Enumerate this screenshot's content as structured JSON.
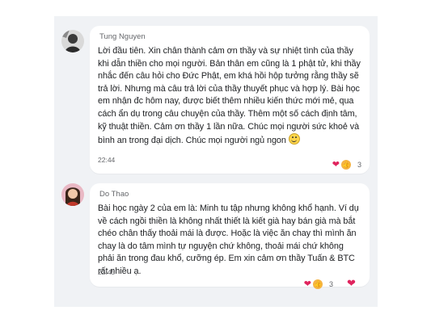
{
  "comments": [
    {
      "author": "Tung Nguyen",
      "text": "Lời đầu tiên. Xin chân thành cảm ơn thầy và sự nhiệt tình của thầy khi dẫn thiền cho mọi người. Bản thân em cũng là 1 phật tử, khi thầy nhắc đến câu hỏi cho Đức Phật, em khá hồi hộp tưởng rằng thầy sẽ trả lời. Nhưng mà câu trả lời của thầy thuyết phục và hợp lý. Bài học em nhận đc hôm nay, được biết thêm nhiều kiến thức mới mẻ, qua cách ẩn dụ trong câu chuyện của thầy. Thêm một số cách định tâm, kỹ thuật thiền. Cảm ơn thầy 1 lần nữa. Chúc mọi người sức khoẻ và bình an trong đại dịch. Chúc mọi người ngủ ngon",
      "time": "22:44",
      "reaction_count": "3",
      "avatar": "avatar-photo-dark"
    },
    {
      "author": "Do Thao",
      "text": "Bài học ngày 2 của em là: Minh tu tập nhưng không khổ hạnh. Ví dụ về cách ngồi thiền là không nhất thiết là kiết già hay bán già mà bắt chéo chân thấy thoải mái là được. Hoặc là việc ăn chay thì mình ăn chay là do tâm mình tự nguyện chứ không, thoải mái chứ không phải ăn trong đau khổ, cưỡng ép. Em xin cảm ơn thầy Tuấn & BTC rất nhiều ạ.",
      "time": "22:45",
      "reaction_count": "3",
      "avatar": "avatar-photo-woman"
    }
  ],
  "icons": {
    "heart": "heart-icon",
    "like": "like-icon",
    "smile": "grinning-face-icon"
  },
  "colors": {
    "heart": "#e0245e",
    "like": "#f5b342",
    "panel_bg": "#f0f2f5"
  }
}
